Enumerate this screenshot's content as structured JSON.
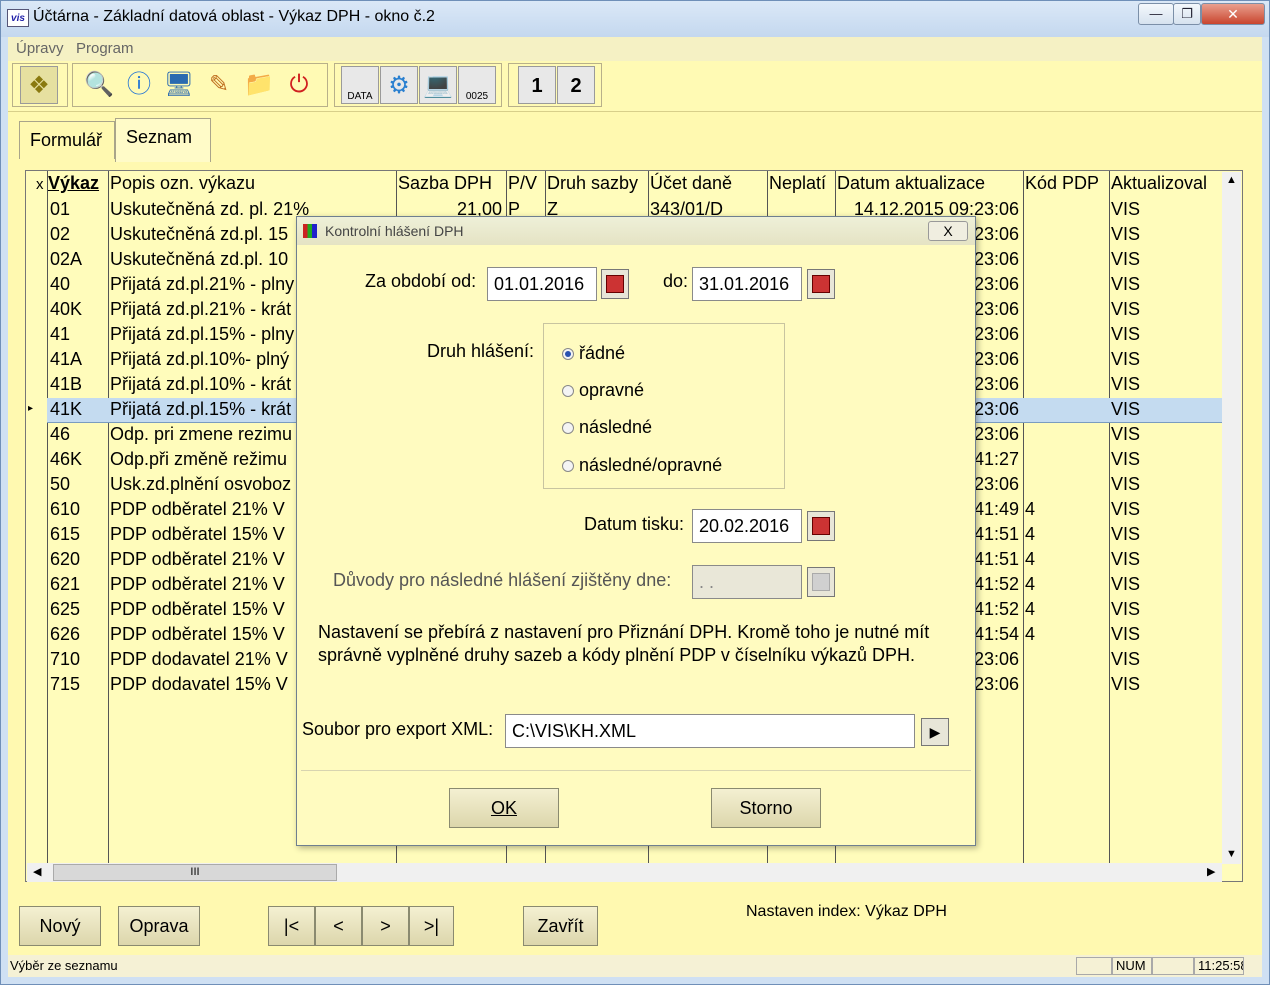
{
  "window": {
    "title": "Účtárna - Základní datová oblast - Výkaz DPH - okno č.2",
    "app_icon_text": "vis"
  },
  "menu": [
    "Úpravy",
    "Program"
  ],
  "toolbar": {
    "data_label": "DATA",
    "mail_label": "0025",
    "page1_label": "1",
    "page2_label": "2"
  },
  "tabs": [
    {
      "label": "Formulář",
      "active": false
    },
    {
      "label": "Seznam",
      "active": true
    }
  ],
  "grid": {
    "columns": [
      "x",
      "Výkaz",
      "Popis ozn. výkazu",
      "Sazba DPH",
      "P/V",
      "Druh sazby",
      "Účet daně",
      "Neplatí",
      "Datum aktualizace",
      "Kód PDP",
      "Aktualizoval"
    ],
    "rows": [
      {
        "vykaz": "01",
        "popis": "Uskutečněná zd. pl. 21%",
        "sazba": "21,00",
        "pv": "P",
        "druh": "Z",
        "ucet": "343/01/D",
        "datum": "14.12.2015 09:23:06",
        "kod": "",
        "akt": "VIS"
      },
      {
        "vykaz": "02",
        "popis": "Uskutečněná zd.pl. 15",
        "datum": "23:06",
        "kod": "",
        "akt": "VIS"
      },
      {
        "vykaz": "02A",
        "popis": "Uskutečněná zd.pl. 10",
        "datum": "23:06",
        "kod": "",
        "akt": "VIS"
      },
      {
        "vykaz": "40",
        "popis": "Přijatá zd.pl.21% - plny",
        "datum": "23:06",
        "kod": "",
        "akt": "VIS"
      },
      {
        "vykaz": "40K",
        "popis": "Přijatá zd.pl.21% - krát",
        "datum": "23:06",
        "kod": "",
        "akt": "VIS"
      },
      {
        "vykaz": "41",
        "popis": "Přijatá zd.pl.15% - plny",
        "datum": "23:06",
        "kod": "",
        "akt": "VIS"
      },
      {
        "vykaz": "41A",
        "popis": "Přijatá zd.pl.10%- plný",
        "datum": "23:06",
        "kod": "",
        "akt": "VIS"
      },
      {
        "vykaz": "41B",
        "popis": "Přijatá zd.pl.10% - krát",
        "datum": "23:06",
        "kod": "",
        "akt": "VIS"
      },
      {
        "vykaz": "41K",
        "popis": "Přijatá zd.pl.15% - krát",
        "datum": "23:06",
        "kod": "",
        "akt": "VIS",
        "selected": true
      },
      {
        "vykaz": "46",
        "popis": "Odp. pri zmene rezimu",
        "datum": "23:06",
        "kod": "",
        "akt": "VIS"
      },
      {
        "vykaz": "46K",
        "popis": "Odp.při změně režimu",
        "datum": "41:27",
        "kod": "",
        "akt": "VIS"
      },
      {
        "vykaz": "50",
        "popis": "Usk.zd.plnění osvoboz",
        "datum": "23:06",
        "kod": "",
        "akt": "VIS"
      },
      {
        "vykaz": "610",
        "popis": "PDP odběratel 21% V",
        "datum": "41:49",
        "kod": "4",
        "akt": "VIS"
      },
      {
        "vykaz": "615",
        "popis": "PDP odběratel 15% V",
        "datum": "41:51",
        "kod": "4",
        "akt": "VIS"
      },
      {
        "vykaz": "620",
        "popis": "PDP odběratel 21% V",
        "datum": "41:51",
        "kod": "4",
        "akt": "VIS"
      },
      {
        "vykaz": "621",
        "popis": "PDP odběratel 21% V",
        "datum": "41:52",
        "kod": "4",
        "akt": "VIS"
      },
      {
        "vykaz": "625",
        "popis": "PDP odběratel 15% V",
        "datum": "41:52",
        "kod": "4",
        "akt": "VIS"
      },
      {
        "vykaz": "626",
        "popis": "PDP odběratel 15% V",
        "datum": "41:54",
        "kod": "4",
        "akt": "VIS"
      },
      {
        "vykaz": "710",
        "popis": "PDP dodavatel 21% V",
        "datum": "23:06",
        "kod": "",
        "akt": "VIS"
      },
      {
        "vykaz": "715",
        "popis": "PDP dodavatel 15% V",
        "datum": "23:06",
        "kod": "",
        "akt": "VIS"
      }
    ],
    "hscroll_grip": "III"
  },
  "buttons": {
    "novy": "Nový",
    "oprava": "Oprava",
    "first": "|<",
    "prev": "<",
    "next": ">",
    "last": ">|",
    "zavrit": "Zavřít"
  },
  "index_note": "Nastaven index: Výkaz DPH",
  "status": {
    "text": "Výběr ze seznamu",
    "num": "NUM",
    "time": "11:25:58"
  },
  "dialog": {
    "title": "Kontrolní hlášení DPH",
    "close": "X",
    "period_label": "Za období od:",
    "period_from": "01.01.2016",
    "period_to_label": "do:",
    "period_to": "31.01.2016",
    "type_label": "Druh hlášení:",
    "types": [
      {
        "label": "řádné",
        "checked": true
      },
      {
        "label": "opravné",
        "checked": false
      },
      {
        "label": "následné",
        "checked": false
      },
      {
        "label": "následné/opravné",
        "checked": false
      }
    ],
    "print_date_label": "Datum tisku:",
    "print_date": "20.02.2016",
    "reasons_label": "Důvody pro následné hlášení zjištěny dne:",
    "reasons_value": ". .",
    "note": "Nastavení se přebírá z nastavení pro Přiznání DPH. Kromě toho je nutné mít správně vyplněné druhy sazeb a kódy plnění PDP v číselníku výkazů DPH.",
    "export_label": "Soubor pro export XML:",
    "export_value": "C:\\VIS\\KH.XML",
    "ok_label": "OK",
    "cancel_label": "Storno"
  }
}
